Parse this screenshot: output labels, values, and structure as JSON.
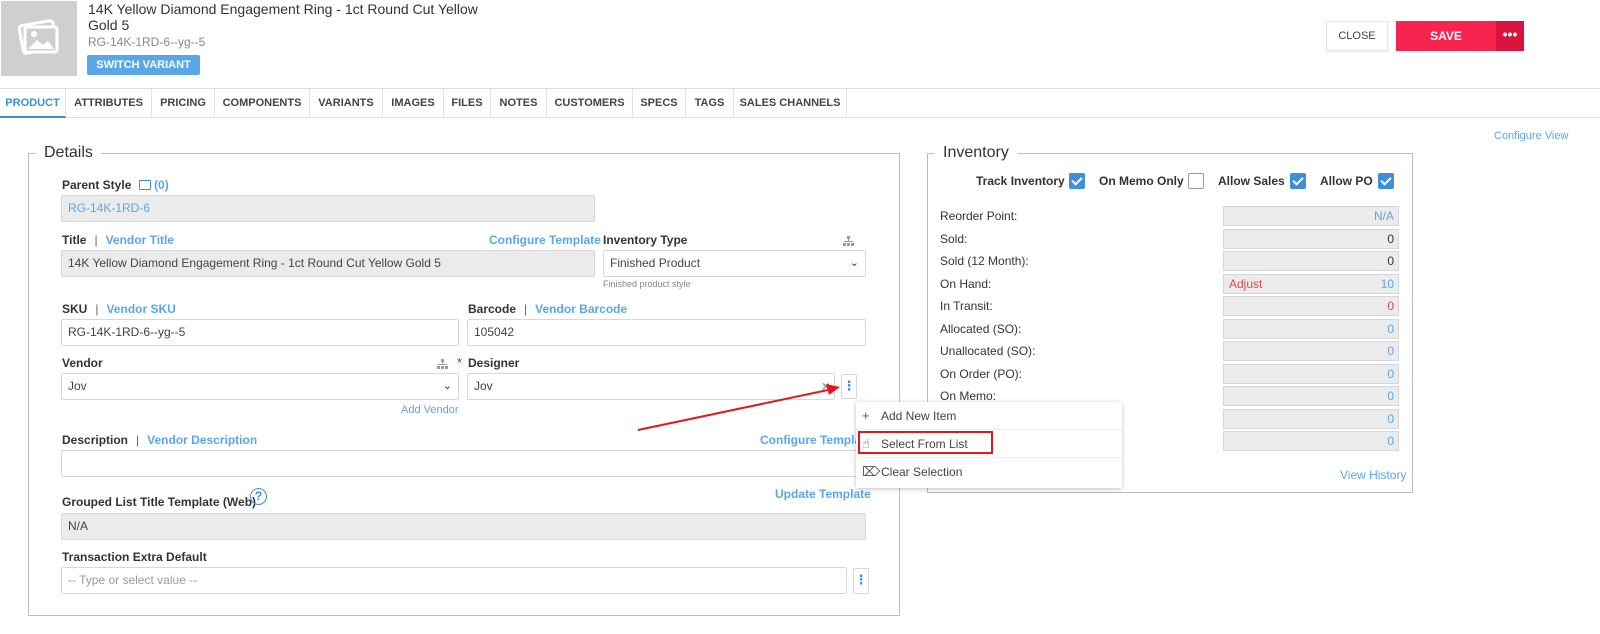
{
  "header": {
    "title_line1": "14K Yellow Diamond Engagement Ring - 1ct Round Cut Yellow",
    "title_line2": "Gold 5",
    "sku": "RG-14K-1RD-6--yg--5",
    "switch_variant": "SWITCH VARIANT",
    "close": "CLOSE",
    "save": "SAVE",
    "more": "•••"
  },
  "tabs": [
    "PRODUCT",
    "ATTRIBUTES",
    "PRICING",
    "COMPONENTS",
    "VARIANTS",
    "IMAGES",
    "FILES",
    "NOTES",
    "CUSTOMERS",
    "SPECS",
    "TAGS",
    "SALES CHANNELS"
  ],
  "configure_view": "Configure View",
  "details": {
    "legend": "Details",
    "parent_style_label": "Parent Style",
    "parent_style_count": "(0)",
    "parent_style_value": "RG-14K-1RD-6",
    "title_label": "Title",
    "vendor_title": "Vendor Title",
    "configure_template": "Configure Template",
    "title_value": "14K Yellow Diamond Engagement Ring - 1ct Round Cut Yellow Gold 5",
    "inventory_type_label": "Inventory Type",
    "inventory_type_value": "Finished Product",
    "inventory_type_hint": "Finished product style",
    "sku_label": "SKU",
    "vendor_sku": "Vendor SKU",
    "sku_value": "RG-14K-1RD-6--yg--5",
    "barcode_label": "Barcode",
    "vendor_barcode": "Vendor Barcode",
    "barcode_value": "105042",
    "vendor_label": "Vendor",
    "vendor_value": "Jov",
    "add_vendor": "Add Vendor",
    "designer_label": "Designer",
    "required_mark": "*",
    "designer_value": "Jov",
    "description_label": "Description",
    "vendor_description": "Vendor Description",
    "configure_template2": "Configure Template",
    "grouped_label": "Grouped List Title Template (Web)",
    "update_template": "Update Template",
    "grouped_value": "N/A",
    "transaction_label": "Transaction Extra Default",
    "transaction_placeholder": "-- Type or select value --"
  },
  "inventory": {
    "legend": "Inventory",
    "track_inventory": "Track Inventory",
    "on_memo_only": "On Memo Only",
    "allow_sales": "Allow Sales",
    "allow_po": "Allow PO",
    "track_inventory_checked": true,
    "on_memo_only_checked": false,
    "allow_sales_checked": true,
    "allow_po_checked": true,
    "rows": [
      {
        "label": "Reorder Point:",
        "value": "N/A",
        "color": "#5aa7e8"
      },
      {
        "label": "Sold:",
        "value": "0",
        "color": "#333333"
      },
      {
        "label": "Sold (12 Month):",
        "value": "0",
        "color": "#333333"
      },
      {
        "label": "On Hand:",
        "value": "10",
        "color": "#5aa7e8",
        "extra": "Adjust"
      },
      {
        "label": "In Transit:",
        "value": "0",
        "color": "#e04b4b"
      },
      {
        "label": "Allocated (SO):",
        "value": "0",
        "color": "#5aa7e8"
      },
      {
        "label": "Unallocated (SO):",
        "value": "0",
        "color": "#5aa7e8"
      },
      {
        "label": "On Order (PO):",
        "value": "0",
        "color": "#5aa7e8"
      },
      {
        "label": "On Memo:",
        "value": "0",
        "color": "#5aa7e8"
      },
      {
        "label": "",
        "value": "0",
        "color": "#5aa7e8"
      },
      {
        "label": "",
        "value": "0",
        "color": "#5aa7e8"
      }
    ],
    "view_history": "View History"
  },
  "context_menu": {
    "items": [
      "Add New Item",
      "Select From List",
      "Clear Selection"
    ],
    "highlighted": "Select From List"
  },
  "colors": {
    "accent": "#3d8fd9",
    "link": "#5aa7e8",
    "save": "#f7244f",
    "annotation": "#e0191f"
  }
}
